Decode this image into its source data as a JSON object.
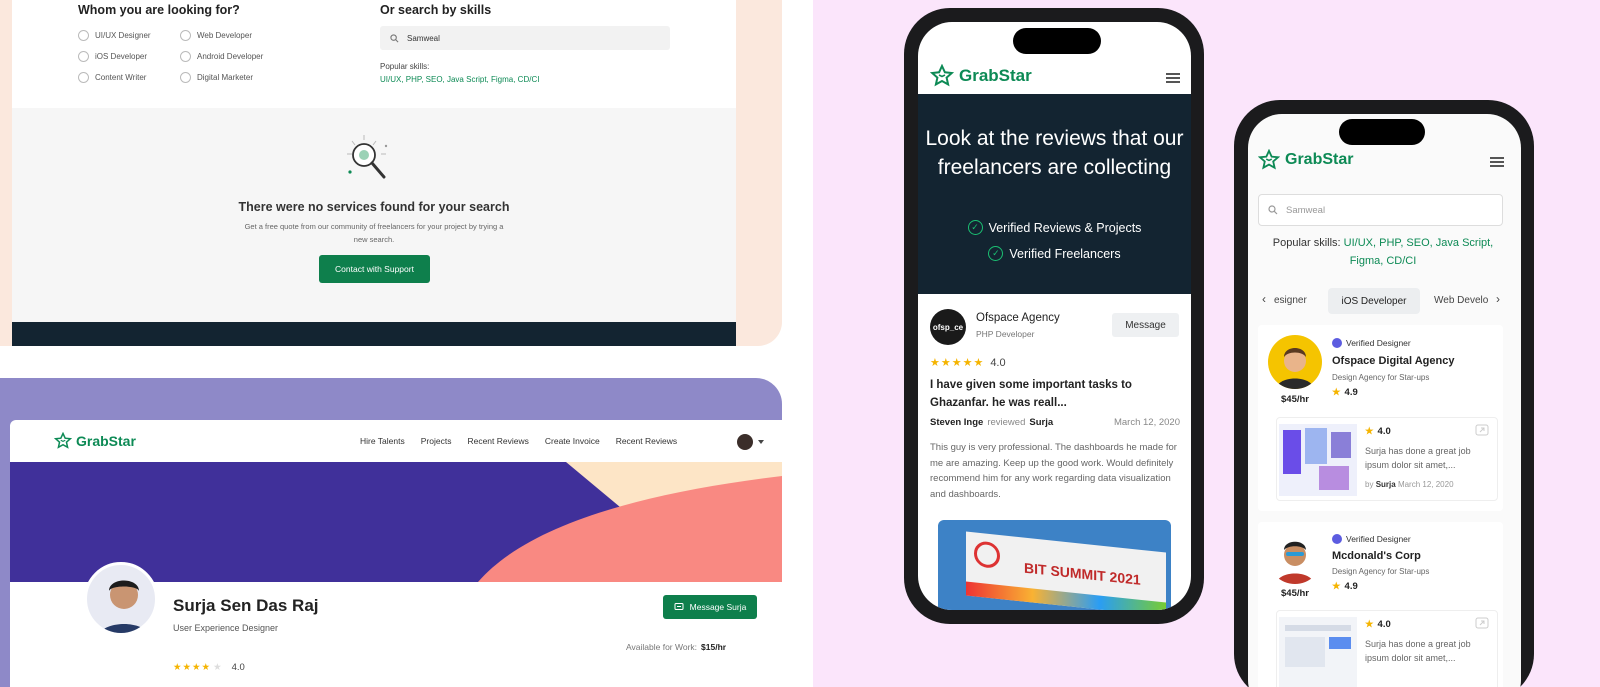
{
  "search_page": {
    "whom_title": "Whom you are looking for?",
    "options_col1": [
      "UI/UX Designer",
      "iOS Developer",
      "Content Writer"
    ],
    "options_col2": [
      "Web Developer",
      "Android Developer",
      "Digital Marketer"
    ],
    "skills_title": "Or search by skills",
    "search_value": "Samweal",
    "popular_label": "Popular skills:",
    "popular_skills": "UI/UX, PHP, SEO, Java Script, Figma, CD/CI",
    "empty_title": "There were no services found for your search",
    "empty_text": "Get a free quote from our community of freelancers for your project by trying a new search.",
    "contact_button": "Contact with Support"
  },
  "profile_page": {
    "brand": "GrabStar",
    "nav": [
      "Hire Talents",
      "Projects",
      "Recent Reviews",
      "Create Invoice",
      "Recent Reviews"
    ],
    "name": "Surja Sen Das Raj",
    "role": "User Experience Designer",
    "message_button": "Message Surja",
    "available_label": "Available for Work:",
    "rate": "$15/hr",
    "rating": "4.0"
  },
  "phone1": {
    "brand": "GrabStar",
    "hero_title": "Look at the reviews that our freelancers are collecting",
    "verified": [
      "Verified Reviews & Projects",
      "Verified Freelancers"
    ],
    "agency": "Ofspace Agency",
    "agency_role": "PHP Developer",
    "message_button": "Message",
    "rating": "4.0",
    "review_title": "I have given some important tasks to Ghazanfar. he was reall...",
    "reviewer": "Steven Inge",
    "reviewed_word": "reviewed",
    "reviewee": "Surja",
    "date": "March 12, 2020",
    "review_body": "This guy is very professional. The dashboards he made for me are amazing. Keep up the good work. Would definitely recommend him for any work regarding data visualization and dashboards.",
    "billboard_text": "BIT SUMMIT 2021"
  },
  "phone2": {
    "brand": "GrabStar",
    "search_value": "Samweal",
    "popular_label": "Popular skills:",
    "popular_skills": "UI/UX, PHP, SEO, Java Script, Figma, CD/CI",
    "tabs": [
      "esigner",
      "iOS Developer",
      "Web Develo"
    ],
    "cards": [
      {
        "badge": "Verified Designer",
        "name": "Ofspace Digital Agency",
        "tagline": "Design Agency for Star-ups",
        "rate": "$45/hr",
        "rating": "4.9",
        "review_rating": "4.0",
        "review_text": "Surja has done a great job ipsum dolor sit amet,...",
        "by": "by",
        "author": "Surja",
        "date": "March 12, 2020"
      },
      {
        "badge": "Verified Designer",
        "name": "Mcdonald's Corp",
        "tagline": "Design Agency for Star-ups",
        "rate": "$45/hr",
        "rating": "4.9",
        "review_rating": "4.0",
        "review_text": "Surja has done a great job ipsum dolor sit amet,..."
      }
    ]
  },
  "colors": {
    "brand_green": "#0d8a55",
    "dark_navy": "#132431",
    "banner_purple": "#40309a",
    "banner_coral": "#f98982",
    "banner_cream": "#fde5c6",
    "page_pink": "#fbe5fb"
  }
}
